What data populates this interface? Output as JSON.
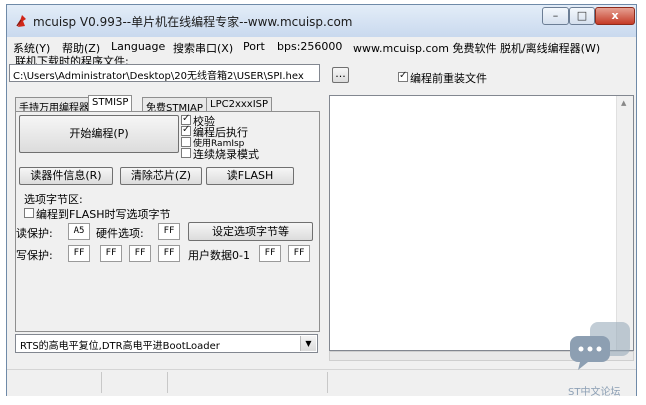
{
  "window": {
    "title": "mcuisp V0.993--单片机在线编程专家--www.mcuisp.com",
    "min_label": "–",
    "max_label": "□",
    "close_label": "x"
  },
  "menu": {
    "items": [
      "系统(Y)",
      "帮助(Z)",
      "Language",
      "搜索串口(X)",
      "Port",
      "bps:256000",
      "www.mcuisp.com 免费软件 脱机/离线编程器(W)"
    ]
  },
  "file": {
    "label": "联机下载时的程序文件:",
    "path": "C:\\Users\\Administrator\\Desktop\\20无线音箱2\\USER\\SPI.hex",
    "browse_label": "...",
    "reload_label": "编程前重装文件"
  },
  "tabs": [
    "手持万用编程器",
    "STMISP",
    "免费STMIAP",
    "LPC2xxxISP"
  ],
  "panel": {
    "start_label": "开始编程(P)",
    "opt_verify": "校验",
    "opt_run_after": "编程后执行",
    "opt_ramisp": "使用RamIsp",
    "opt_continuous": "连续烧录模式",
    "read_info_label": "读器件信息(R)",
    "erase_label": "清除芯片(Z)",
    "read_flash_label": "读FLASH",
    "option_section_label": "选项字节区:",
    "write_option_label": "编程到FLASH时写选项字节",
    "read_protect_label": "读保护:",
    "read_protect_value": "A5",
    "hw_option_label": "硬件选项:",
    "hw_option_value": "FF",
    "set_option_label": "设定选项字节等",
    "write_protect_label": "写保护:",
    "write_protect_values": [
      "FF",
      "FF",
      "FF",
      "FF"
    ],
    "user_data_label": "用户数据0-1",
    "user_data_values": [
      "FF",
      "FF"
    ]
  },
  "reset_mode": {
    "selected": "RTS的高电平复位,DTR高电平进BootLoader"
  },
  "watermark": {
    "text": "ST中文论坛"
  },
  "colors": {
    "accent": "#3a6ea5",
    "close": "#c53b27"
  }
}
